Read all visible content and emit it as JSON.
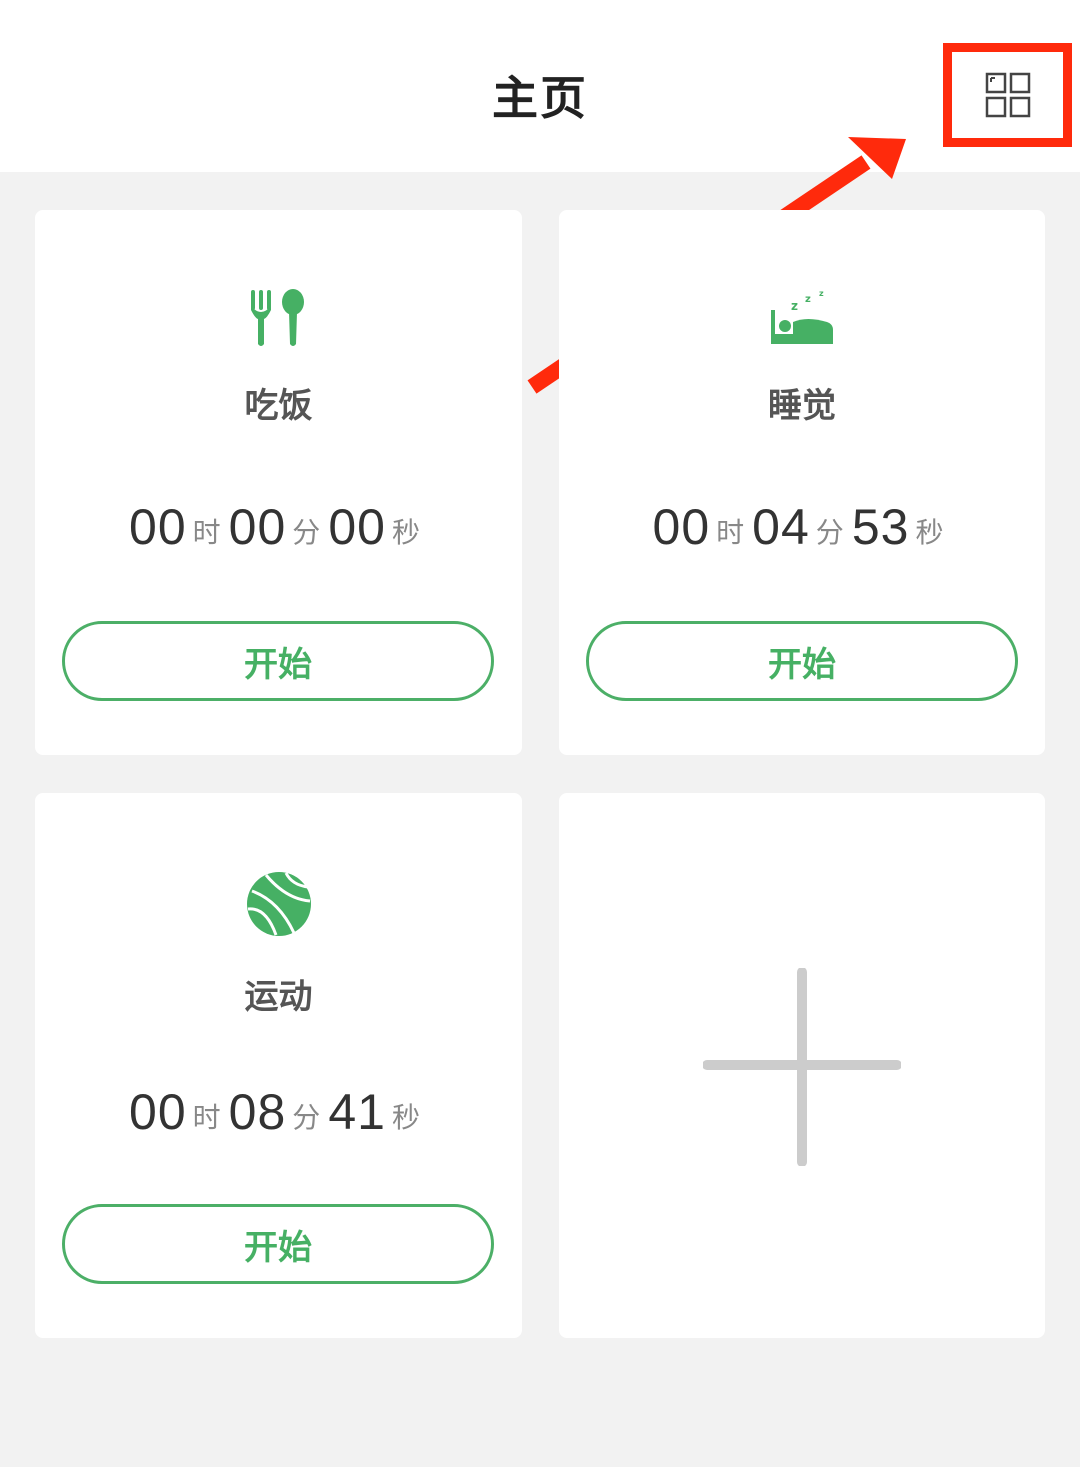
{
  "header": {
    "title": "主页",
    "layout_icon": "grid-layout-icon"
  },
  "units": {
    "hour": "时",
    "minute": "分",
    "second": "秒"
  },
  "cards": [
    {
      "label": "吃饭",
      "icon": "fork-spoon-icon",
      "hours": "00",
      "minutes": "00",
      "seconds": "00",
      "button": "开始"
    },
    {
      "label": "睡觉",
      "icon": "sleep-bed-icon",
      "hours": "00",
      "minutes": "04",
      "seconds": "53",
      "button": "开始"
    },
    {
      "label": "运动",
      "icon": "basketball-icon",
      "hours": "00",
      "minutes": "08",
      "seconds": "41",
      "button": "开始"
    }
  ],
  "add_card": {
    "icon": "plus-icon"
  },
  "colors": {
    "accent_green": "#46b064",
    "highlight_red": "#ff2a0c",
    "background": "#f2f2f2"
  }
}
